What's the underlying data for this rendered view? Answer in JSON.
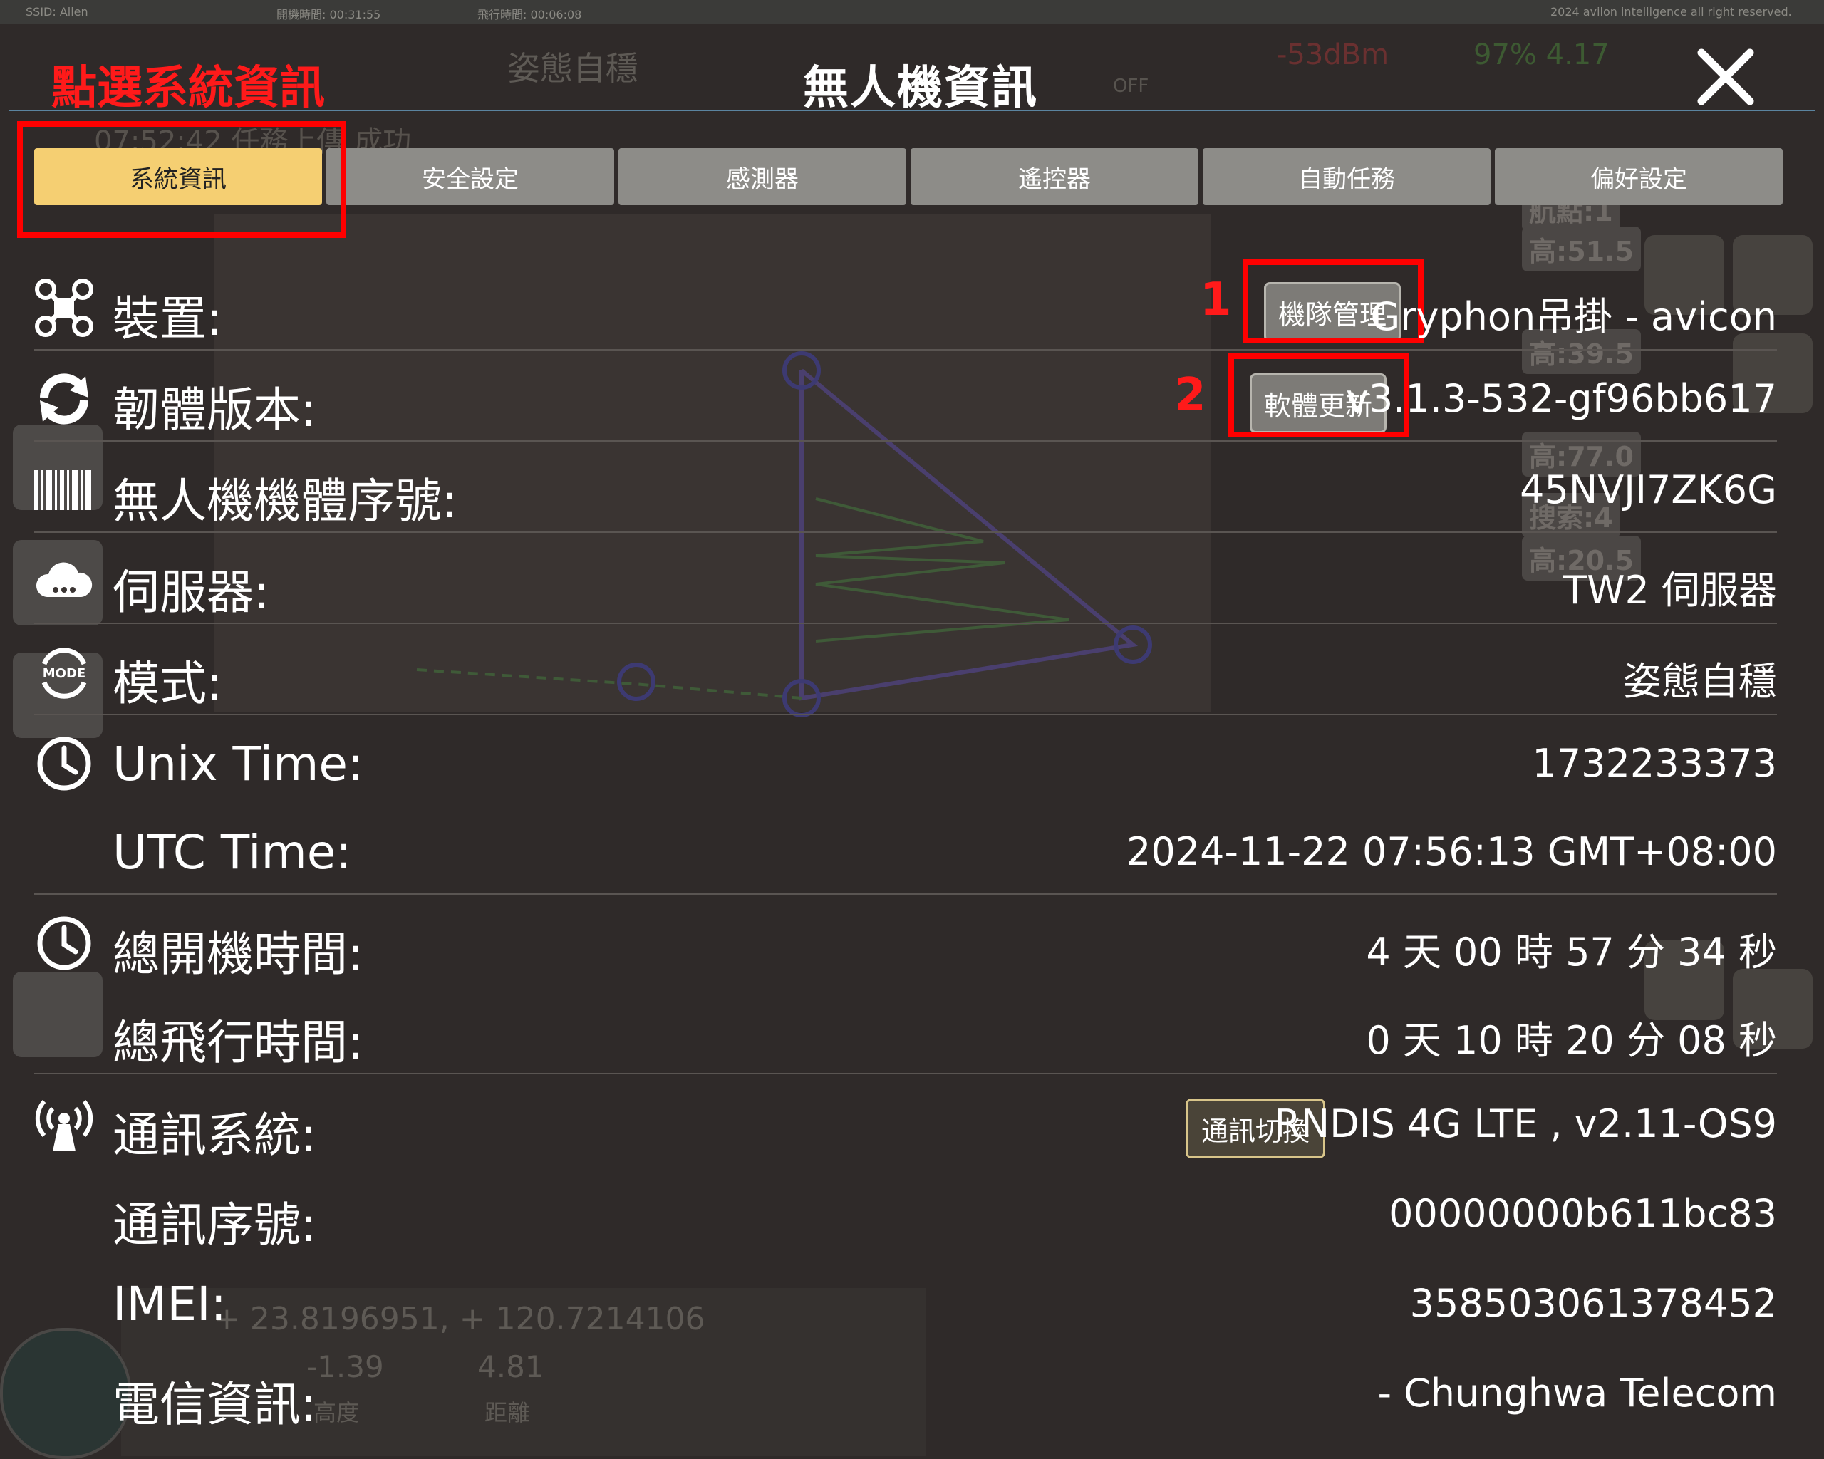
{
  "status_strip": {
    "ssid": "SSID: Allen",
    "boot_time": "開機時間: 00:31:55",
    "flight_time": "飛行時間: 00:06:08",
    "copyright": "2024 avilon intelligence all right reserved."
  },
  "header": {
    "title": "無人機資訊",
    "annotation": "點選系統資訊"
  },
  "tabs": [
    {
      "label": "系統資訊"
    },
    {
      "label": "安全設定"
    },
    {
      "label": "感測器"
    },
    {
      "label": "遙控器"
    },
    {
      "label": "自動任務"
    },
    {
      "label": "偏好設定"
    }
  ],
  "rows": {
    "device": {
      "label": "裝置:",
      "value": "Gryphon吊掛 - avicon",
      "button": "機隊管理",
      "annotation": "1"
    },
    "firmware": {
      "label": "韌體版本:",
      "value": "v3.1.3-532-gf96bb617",
      "button": "軟體更新",
      "annotation": "2"
    },
    "serial": {
      "label": "無人機機體序號:",
      "value": "45NVJI7ZK6G"
    },
    "server": {
      "label": "伺服器:",
      "value": "TW2 伺服器"
    },
    "mode": {
      "label": "模式:",
      "value": "姿態自穩",
      "icon_text": "MODE"
    },
    "unix_time": {
      "label": "Unix Time:",
      "value": "1732233373"
    },
    "utc_time": {
      "label": "UTC Time:",
      "value": "2024-11-22 07:56:13 GMT+08:00"
    },
    "total_power_on": {
      "label": "總開機時間:",
      "value": "4 天 00 時 57 分 34 秒"
    },
    "total_flight": {
      "label": "總飛行時間:",
      "value": "0 天 10 時 20 分 08 秒"
    },
    "comm_system": {
      "label": "通訊系統:",
      "value": "RNDIS 4G LTE , v2.11-OS9",
      "button": "通訊切換"
    },
    "comm_serial": {
      "label": "通訊序號:",
      "value": "00000000b611bc83"
    },
    "imei": {
      "label": "IMEI:",
      "value": "358503061378452"
    },
    "telecom": {
      "label": "電信資訊:",
      "value": "- Chunghwa Telecom"
    }
  },
  "background": {
    "attitude_label": "姿態自穩",
    "signal": "-53dBm",
    "battery": "97% 4.17",
    "coords": "+ 23.8196951, + 120.7214106",
    "altitude": "-1.39",
    "altitude_label": "高度",
    "distance": "4.81",
    "distance_label": "距離",
    "waypoint1": "航點:1",
    "height1": "高:51.5",
    "height2": "高:39.5",
    "height3": "高:77.0",
    "search": "搜索:4",
    "height4": "高:20.5",
    "off_label": "OFF",
    "upload_msg": "07:52:42 任務上傳 成功"
  },
  "colors": {
    "tab_active": "#f5cf72",
    "tab_inactive": "#8d8c88",
    "annotation": "#ff0000",
    "background": "#2f2a29"
  },
  "icons": {
    "device": "drone-icon",
    "firmware": "sync-icon",
    "serial": "barcode-icon",
    "server": "cloud-icon",
    "mode": "mode-icon",
    "time": "clock-icon",
    "comm": "antenna-icon",
    "close": "close-icon"
  }
}
